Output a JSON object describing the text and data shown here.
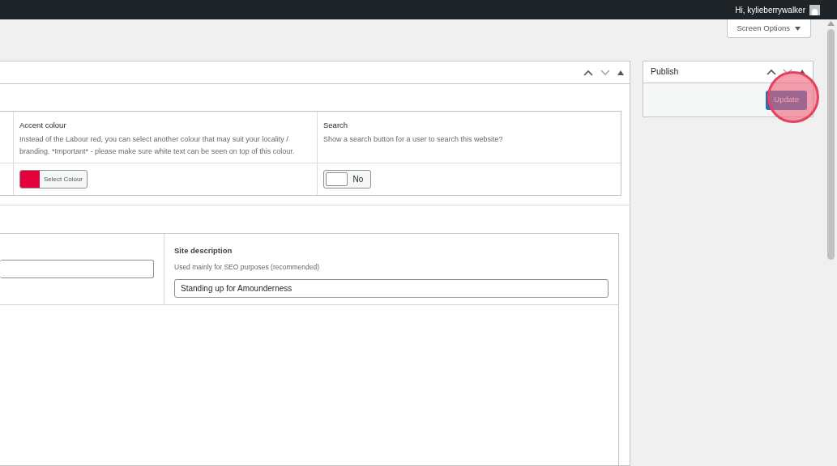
{
  "admin_bar": {
    "greeting": "Hi, kylieberrywalker"
  },
  "screen_options": {
    "label": "Screen Options"
  },
  "settings_table": {
    "columns": [
      {
        "title": "Accent colour",
        "description": "Instead of the Labour red, you can select another colour that may suit your locality / branding. *Important* - please make sure white text can be seen on top of this colour.",
        "kind": "colour",
        "color": "#e4003b",
        "button": "Select Colour"
      },
      {
        "title": "Search",
        "description": "Show a search button for a user to search this website?",
        "kind": "toggle",
        "on": false,
        "label": "No"
      }
    ]
  },
  "site_description": {
    "title": "Site description",
    "description": "Used mainly for SEO purposes (recommended)",
    "value": "Standing up for Amounderness"
  },
  "publish": {
    "title": "Publish",
    "button": "Update"
  }
}
